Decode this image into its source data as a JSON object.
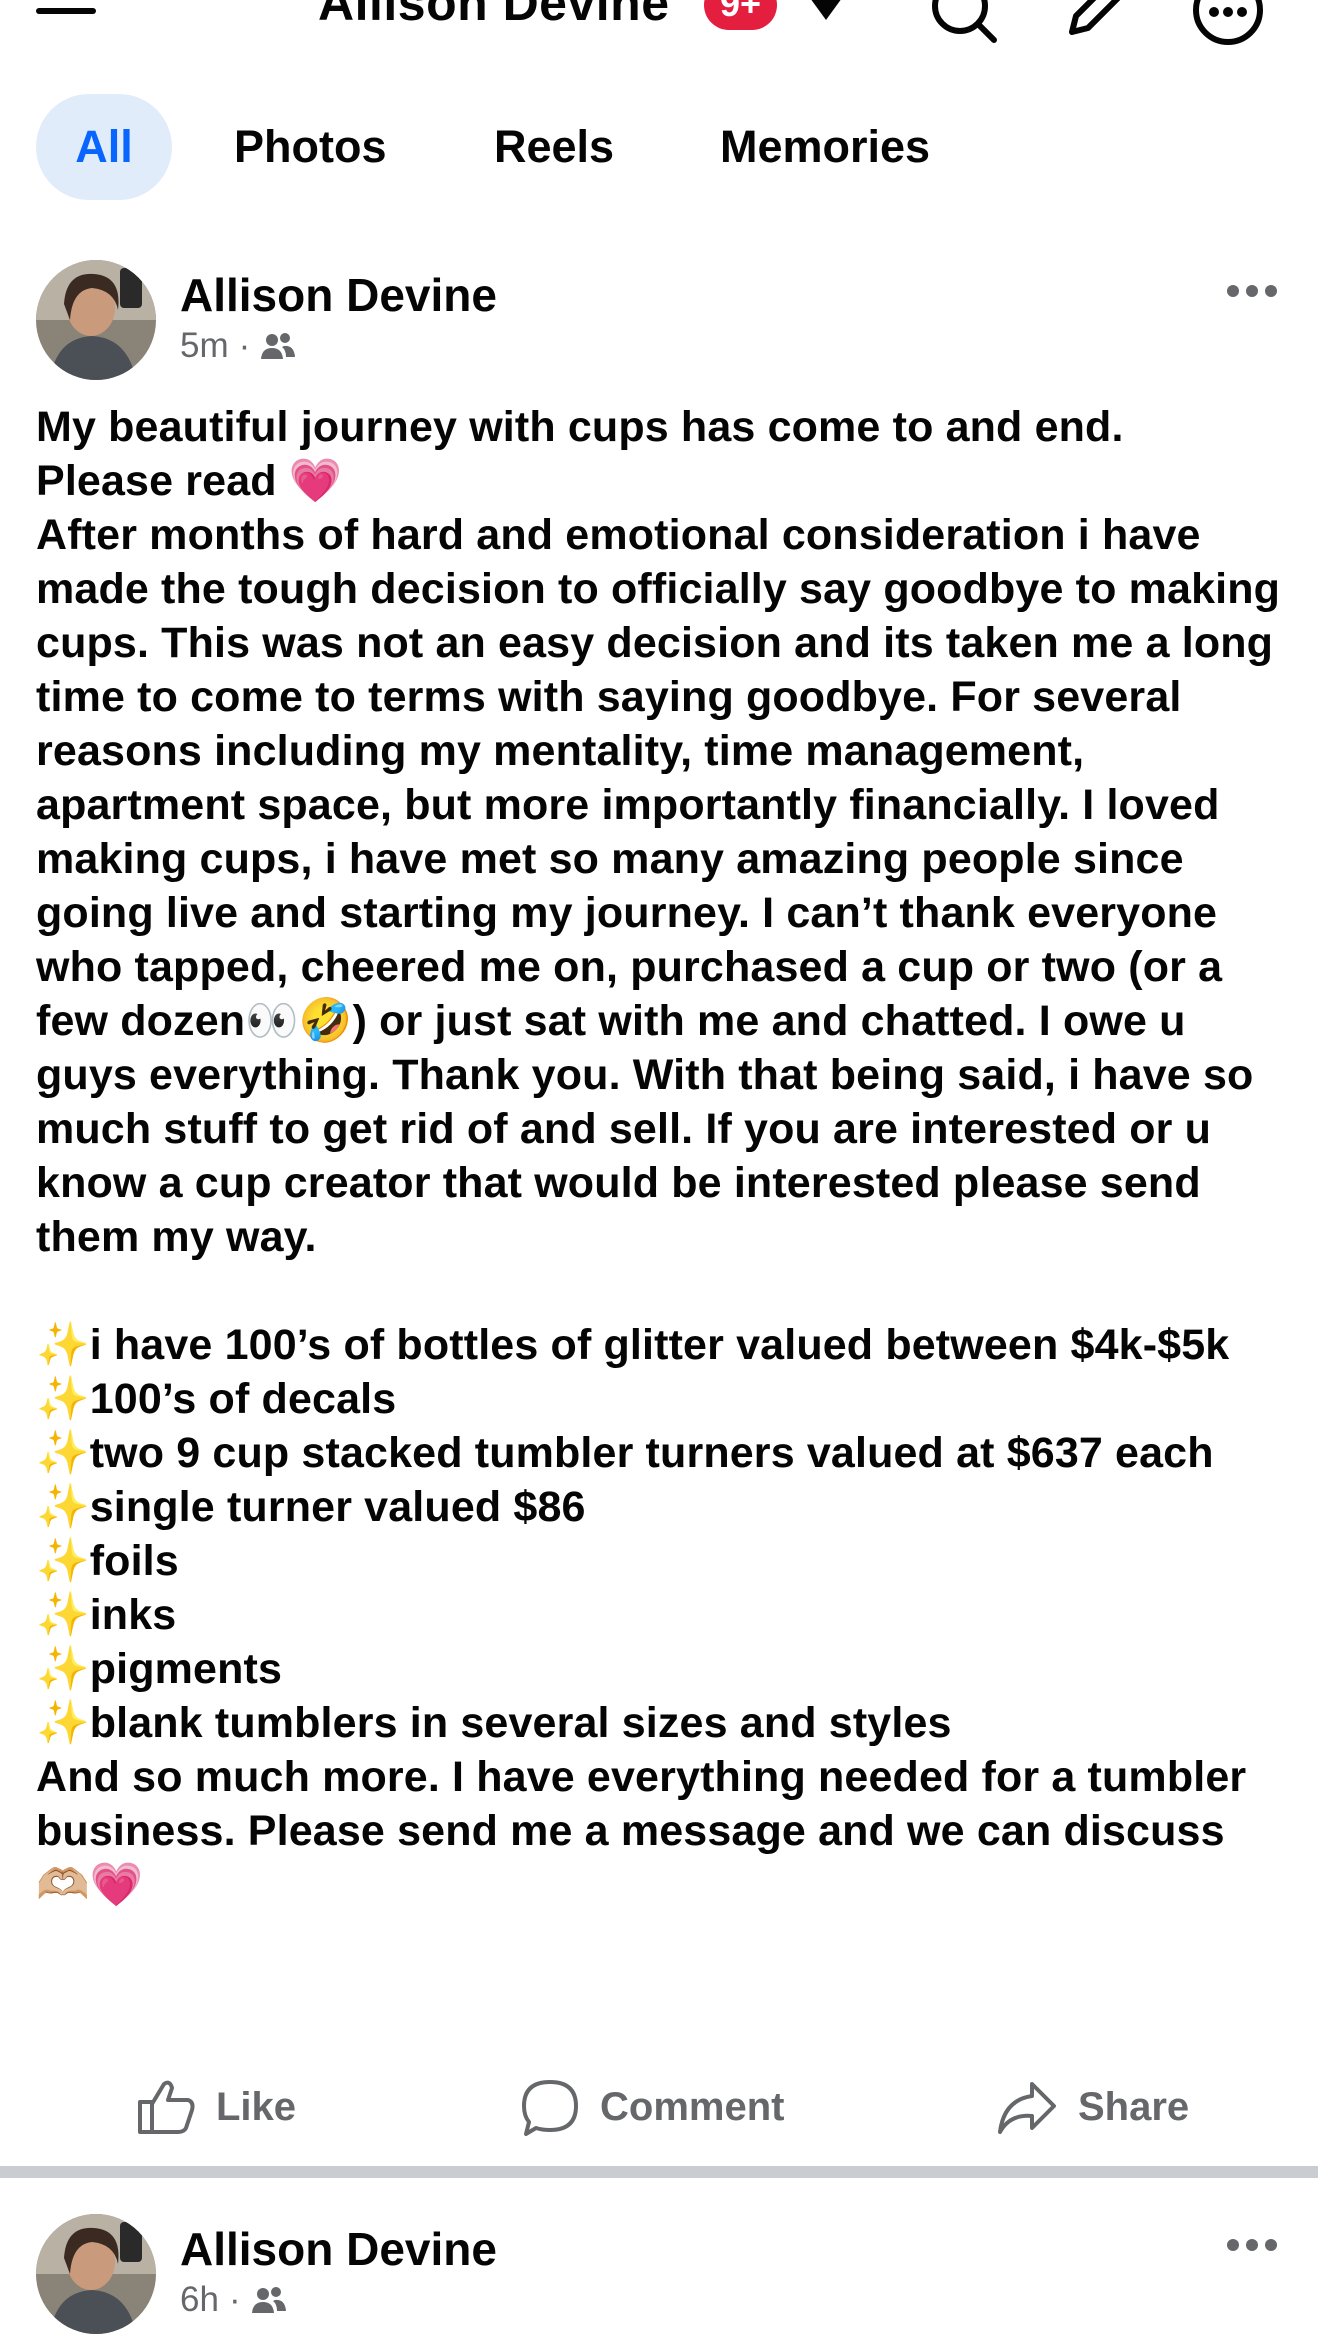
{
  "header": {
    "profile_name": "Allison Devine",
    "notification_badge": "9+",
    "icons": [
      "menu-icon",
      "chevron-down-icon",
      "search-icon",
      "edit-icon",
      "more-icon"
    ]
  },
  "tabs": [
    {
      "label": "All",
      "selected": true
    },
    {
      "label": "Photos",
      "selected": false
    },
    {
      "label": "Reels",
      "selected": false
    },
    {
      "label": "Memories",
      "selected": false
    }
  ],
  "colors": {
    "accent": "#0866ff",
    "tab_selected_bg": "#e1ecfb",
    "badge": "#e41e3f",
    "secondary_text": "#65676b",
    "heart": "#ff3ab5"
  },
  "posts": [
    {
      "author": "Allison Devine",
      "time": "5m",
      "audience_icon": "friends-icon",
      "text": "My beautiful journey with cups has come to and end.\nPlease read 💗\nAfter months of hard and emotional consideration i have made the tough decision to officially say goodbye to making cups. This was not an easy decision and its taken me a long time to come to terms with saying goodbye. For several reasons including my mentality, time management, apartment space, but more importantly financially. I loved making cups, i have met so many amazing people since going live and starting my journey. I can’t thank everyone who tapped, cheered me on, purchased a cup or two (or a few dozen👀🤣) or just sat with me and chatted. I owe u guys everything. Thank you. With that being said, i have so much stuff to get rid of and sell. If you are interested or u know a cup creator that would be interested please send them my way.\n\n✨i have 100’s of bottles of glitter valued between $4k-$5k\n✨100’s of decals\n✨two 9 cup stacked tumbler turners valued at $637 each\n✨single turner valued $86\n✨foils\n✨inks\n✨pigments\n✨blank tumblers in several sizes and styles\nAnd so much more. I have everything needed for a tumbler business. Please send me a message and we can discuss 🫶🏼💗",
      "actions": {
        "like": "Like",
        "comment": "Comment",
        "share": "Share"
      }
    },
    {
      "author": "Allison Devine",
      "time": "6h",
      "audience_icon": "friends-icon"
    }
  ]
}
